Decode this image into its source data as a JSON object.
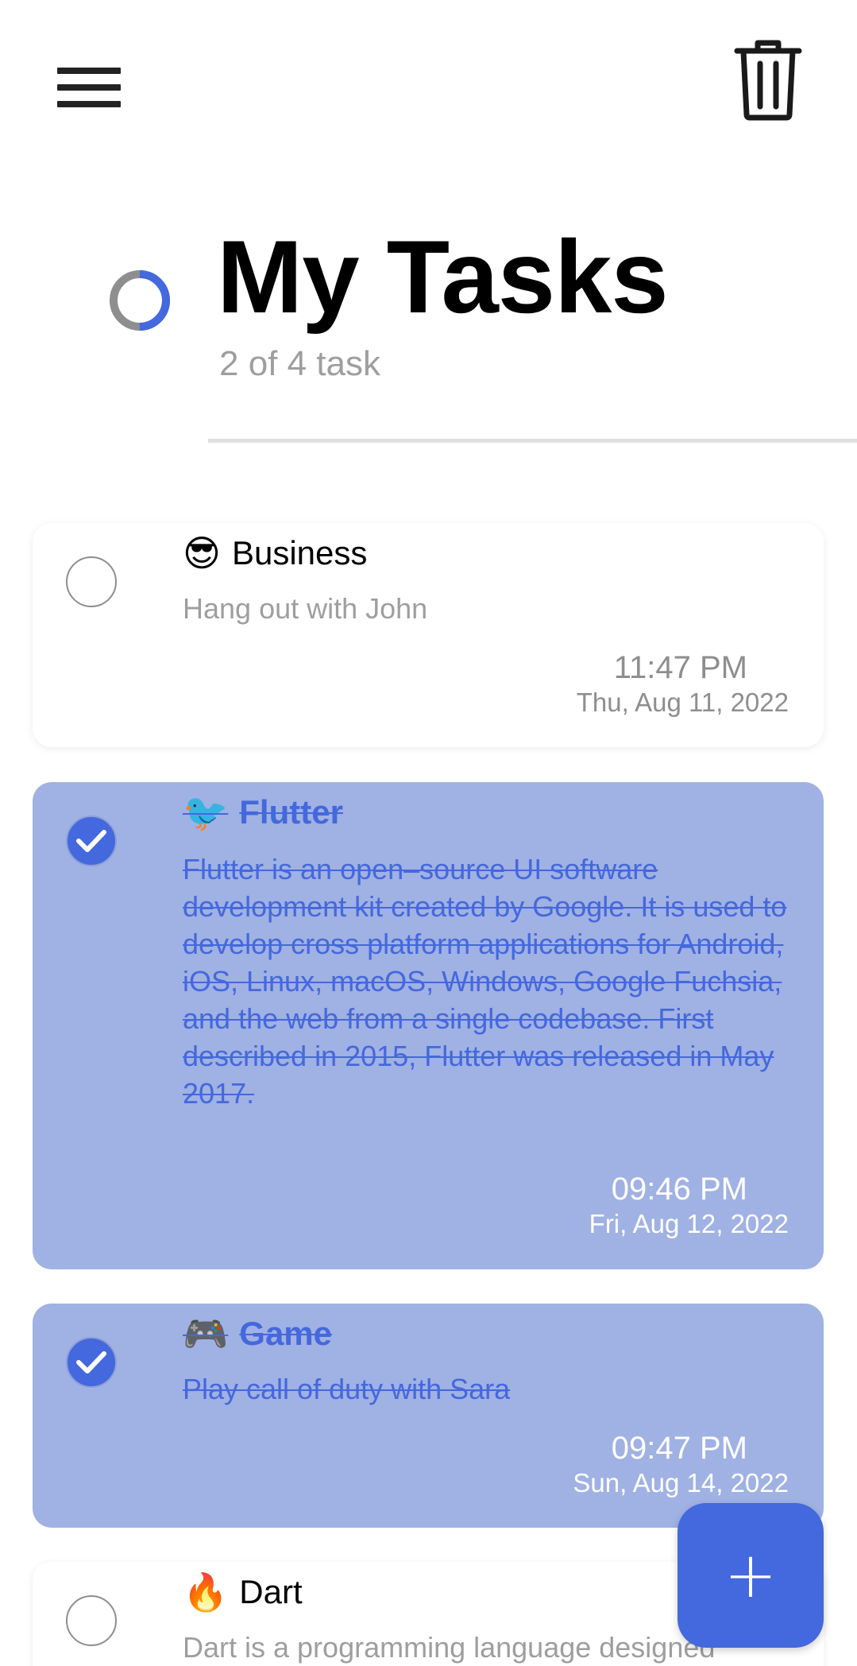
{
  "header": {
    "title": "My Tasks",
    "task_count": "2 of 4 task",
    "progress_fraction": 0.5
  },
  "icons": {
    "menu": "menu-icon",
    "trash": "trash-icon",
    "add": "plus-icon"
  },
  "colors": {
    "accent": "#4468dd",
    "completed_card": "#a0b1e3",
    "muted_text": "#9e9e9e"
  },
  "tasks": [
    {
      "emoji": "😎",
      "category": "Business",
      "description": "Hang out with John",
      "time": "11:47 PM",
      "date": "Thu, Aug 11, 2022",
      "completed": false
    },
    {
      "emoji": "🐦",
      "category": "Flutter",
      "description": "Flutter is an open–source UI software development kit created by Google. It is used to develop cross platform applications for Android, iOS, Linux, macOS, Windows, Google Fuchsia, and the web from a single codebase. First described in 2015, Flutter was released in May 2017.",
      "time": "09:46 PM",
      "date": "Fri, Aug 12, 2022",
      "completed": true
    },
    {
      "emoji": "🎮",
      "category": "Game",
      "description": "Play call of duty with Sara",
      "time": "09:47 PM",
      "date": "Sun, Aug 14, 2022",
      "completed": true
    },
    {
      "emoji": "🔥",
      "category": "Dart",
      "description": "Dart is a programming language designed",
      "completed": false
    }
  ],
  "fab": {
    "label": "+"
  }
}
